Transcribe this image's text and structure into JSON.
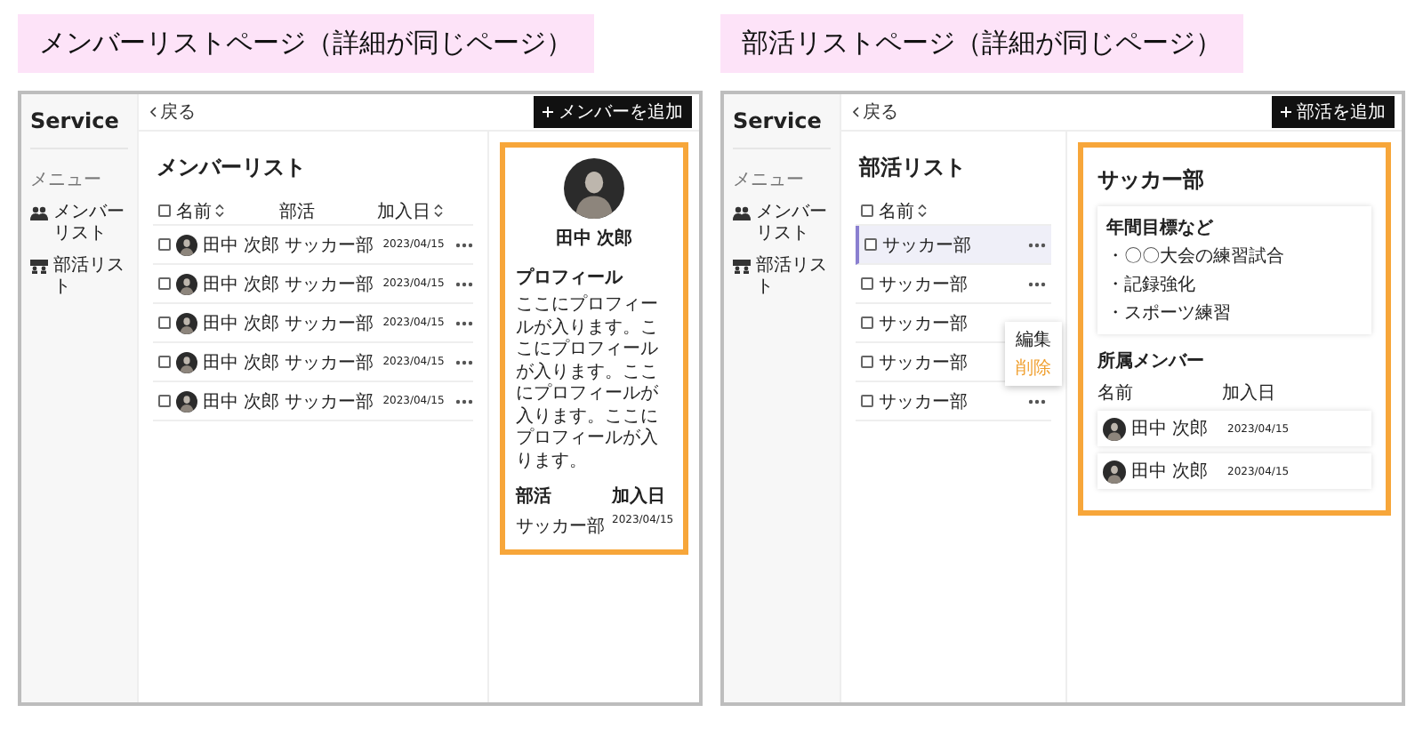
{
  "screens": [
    {
      "caption": "メンバーリストページ（詳細が同じページ）",
      "brand": "Service",
      "back": "戻る",
      "add_button": "メンバーを追加",
      "menu_label": "メニュー",
      "nav": [
        "メンバーリスト",
        "部活リスト"
      ],
      "list": {
        "title": "メンバーリスト",
        "kind": "members",
        "all_checked": false,
        "columns": [
          {
            "label": "名前",
            "sortable": true
          },
          {
            "label": "部活",
            "sortable": false
          },
          {
            "label": "加入日",
            "sortable": true
          }
        ],
        "rows": [
          {
            "name": "田中 次郎",
            "club": "サッカー部",
            "joined": "2023/04/15",
            "checked": false
          },
          {
            "name": "田中 次郎",
            "club": "サッカー部",
            "joined": "2023/04/15",
            "checked": false
          },
          {
            "name": "田中 次郎",
            "club": "サッカー部",
            "joined": "2023/04/15",
            "checked": false
          },
          {
            "name": "田中 次郎",
            "club": "サッカー部",
            "joined": "2023/04/15",
            "checked": false
          },
          {
            "name": "田中 次郎",
            "club": "サッカー部",
            "joined": "2023/04/15",
            "checked": false
          }
        ]
      },
      "detail": {
        "kind": "profile",
        "name": "田中 次郎",
        "profile_heading": "プロフィール",
        "profile": "ここにプロフィールが入ります。ここにプロフィールが入ります。ここにプロフィールが入ります。ここにプロフィールが入ります。",
        "fields": [
          {
            "label": "部活",
            "value": "サッカー部"
          },
          {
            "label": "加入日",
            "value": "2023/04/15"
          }
        ]
      }
    },
    {
      "caption": "部活リストページ（詳細が同じページ）",
      "brand": "Service",
      "back": "戻る",
      "add_button": "部活を追加",
      "menu_label": "メニュー",
      "nav": [
        "メンバーリスト",
        "部活リスト"
      ],
      "list": {
        "title": "部活リスト",
        "kind": "clubs",
        "all_checked": false,
        "columns": [
          {
            "label": "名前",
            "sortable": true
          }
        ],
        "rows": [
          {
            "name": "サッカー部",
            "checked": false,
            "selected": true
          },
          {
            "name": "サッカー部",
            "checked": false,
            "selected": false
          },
          {
            "name": "サッカー部",
            "checked": false,
            "selected": false,
            "popup": [
              {
                "label": "編集",
                "kind": "normal"
              },
              {
                "label": "削除",
                "kind": "danger"
              }
            ]
          },
          {
            "name": "サッカー部",
            "checked": false,
            "selected": false
          },
          {
            "name": "サッカー部",
            "checked": false,
            "selected": false
          }
        ]
      },
      "detail": {
        "kind": "club",
        "title": "サッカー部",
        "goals_heading": "年間目標など",
        "goals": [
          "・〇〇大会の練習試合",
          "・記録強化",
          "・スポーツ練習"
        ],
        "members_heading": "所属メンバー",
        "member_columns": [
          "名前",
          "加入日"
        ],
        "members": [
          {
            "name": "田中 次郎",
            "joined": "2023/04/15"
          },
          {
            "name": "田中 次郎",
            "joined": "2023/04/15"
          }
        ]
      }
    }
  ]
}
